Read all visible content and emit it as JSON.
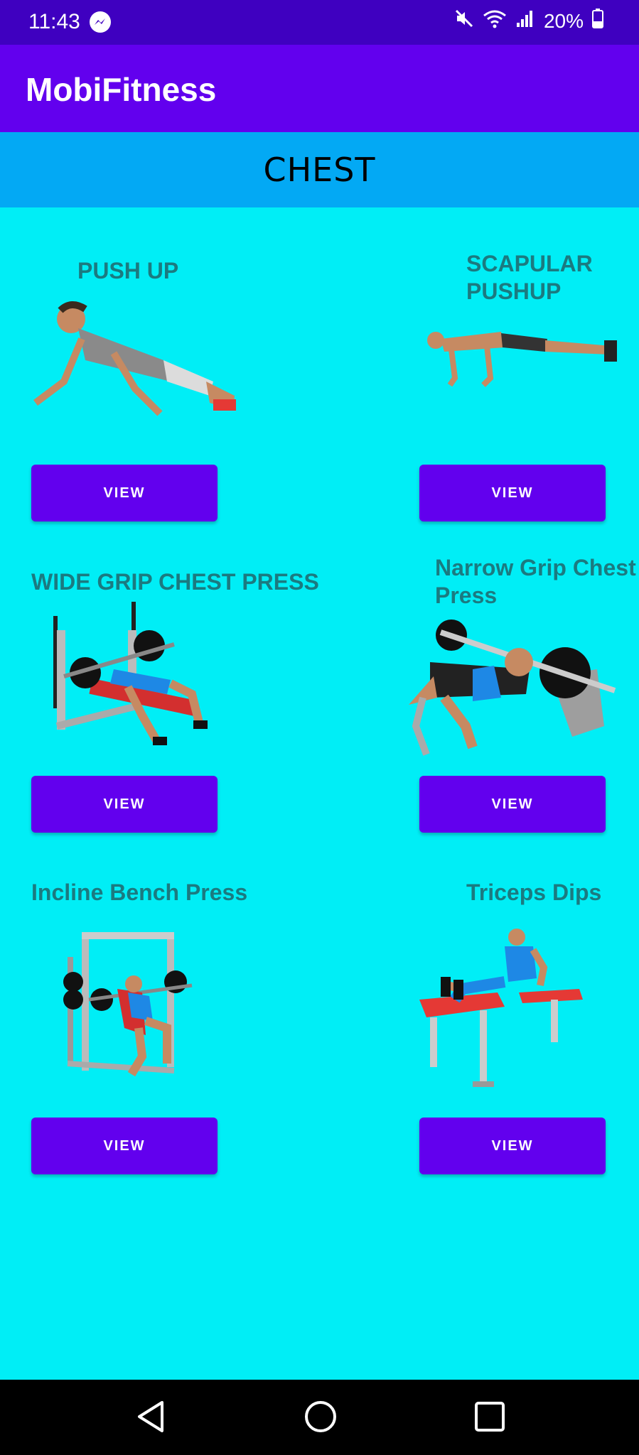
{
  "status_bar": {
    "time": "11:43",
    "battery": "20%"
  },
  "app_bar": {
    "title": "MobiFitness"
  },
  "section": {
    "title": "CHEST"
  },
  "exercises": [
    {
      "title": "PUSH UP",
      "button": "VIEW"
    },
    {
      "title": "SCAPULAR\nPUSHUP",
      "button": "VIEW"
    },
    {
      "title": "WIDE GRIP CHEST PRESS",
      "button": "VIEW"
    },
    {
      "title": "Narrow Grip Chest\nPress",
      "button": "VIEW"
    },
    {
      "title": "Incline Bench Press",
      "button": "VIEW"
    },
    {
      "title": "Triceps Dips",
      "button": "VIEW"
    }
  ],
  "colors": {
    "status_bar": "#3F00C0",
    "app_bar": "#6200EE",
    "section_header": "#03A9F4",
    "background": "#00EEF6",
    "button": "#6200EE",
    "title_text": "#1B7A80"
  },
  "icons": [
    "messenger-icon",
    "mute-icon",
    "wifi-icon",
    "signal-icon",
    "battery-icon",
    "back-icon",
    "home-icon",
    "recents-icon"
  ]
}
